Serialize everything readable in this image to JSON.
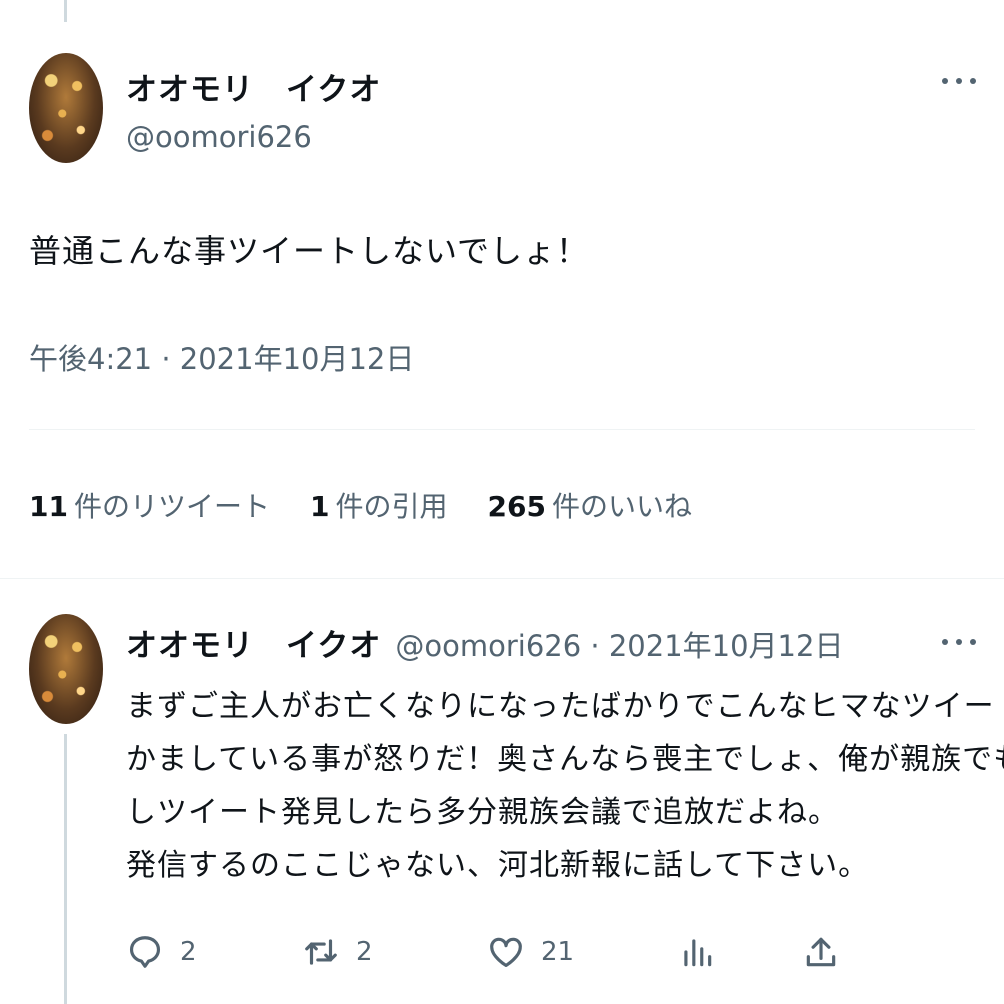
{
  "main_tweet": {
    "display_name": "オオモリ　イクオ",
    "handle": "@oomori626",
    "text": "普通こんな事ツイートしないでしょ！",
    "timestamp": "午後4:21 · 2021年10月12日",
    "stats": {
      "retweets_count": "11",
      "retweets_label": "件のリツイート",
      "quotes_count": "1",
      "quotes_label": "件の引用",
      "likes_count": "265",
      "likes_label": "件のいいね"
    }
  },
  "reply_tweet": {
    "display_name": "オオモリ　イクオ",
    "handle_date": "@oomori626 · 2021年10月12日",
    "lines": [
      "まずご主人がお亡くなりになったばかりでこんなヒマなツイート",
      "かましている事が怒りだ！奥さんなら喪主でしょ、俺が親族でも",
      "しツイート発見したら多分親族会議で追放だよね。",
      "発信するのここじゃない、河北新報に話して下さい。"
    ],
    "actions": {
      "reply_count": "2",
      "retweet_count": "2",
      "like_count": "21"
    }
  },
  "icons": [
    "more-icon",
    "reply-icon",
    "retweet-icon",
    "like-icon",
    "analytics-icon",
    "share-icon"
  ],
  "colors": {
    "text": "#0f1419",
    "secondary": "#536471",
    "divider": "#eff3f4",
    "thread_line": "#cfd9de"
  }
}
